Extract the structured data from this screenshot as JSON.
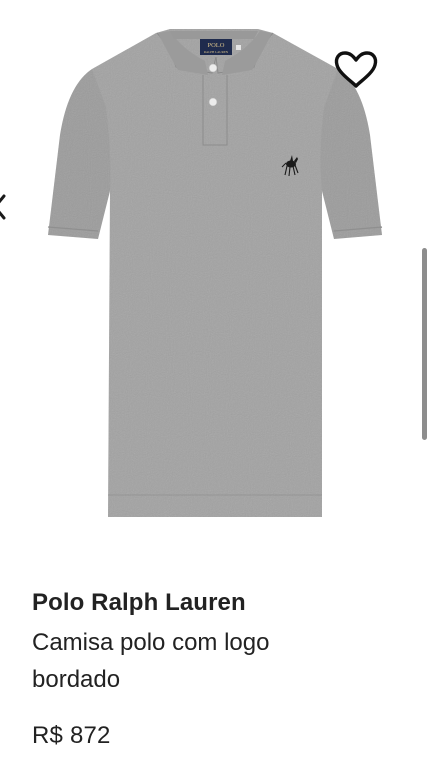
{
  "product": {
    "brand": "Polo Ralph Lauren",
    "description": "Camisa polo com logo bordado",
    "price": "R$ 872",
    "image_label": "POLO RALPH LAUREN",
    "image_color": "#a2a2a2"
  },
  "icons": {
    "wishlist": "heart-icon",
    "carousel_prev": "chevron-left-icon"
  },
  "colors": {
    "text": "#222222",
    "scrollbar": "#8d8d8d"
  }
}
